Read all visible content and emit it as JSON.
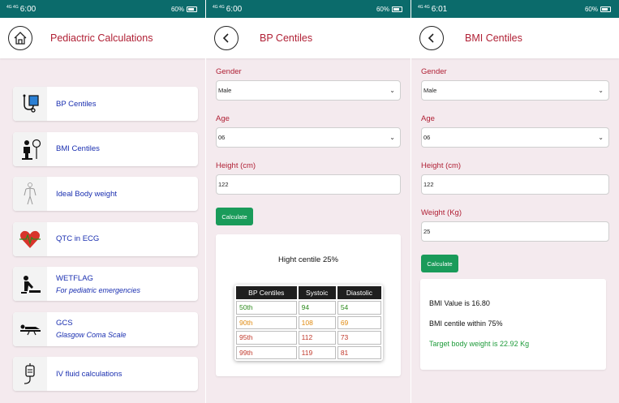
{
  "status_bars": [
    {
      "signal": "4G 4G",
      "time": "6:00",
      "battery": "60%"
    },
    {
      "signal": "4G 4G",
      "time": "6:00",
      "battery": "60%"
    },
    {
      "signal": "4G 4G",
      "time": "6:01",
      "battery": "60%"
    }
  ],
  "screen1": {
    "title": "Pediactric Calculations",
    "items": [
      {
        "label": "BP Centiles",
        "sub": "",
        "icon": "bp-monitor-icon"
      },
      {
        "label": "BMI Centiles",
        "sub": "",
        "icon": "bmi-scale-icon"
      },
      {
        "label": "Ideal Body weight",
        "sub": "",
        "icon": "body-figure-icon"
      },
      {
        "label": "QTC in ECG",
        "sub": "",
        "icon": "heart-ecg-icon"
      },
      {
        "label": "WETFLAG",
        "sub": "For pediatric emergencies",
        "icon": "cpr-icon"
      },
      {
        "label": "GCS",
        "sub": "Glasgow Coma Scale",
        "icon": "lying-person-icon"
      },
      {
        "label": "IV fluid calculations",
        "sub": "",
        "icon": "iv-drip-icon"
      }
    ]
  },
  "screen2": {
    "title": "BP Centiles",
    "gender_label": "Gender",
    "gender_value": "Male",
    "age_label": "Age",
    "age_value": "06",
    "height_label": "Height (cm)",
    "height_value": "122",
    "calc_label": "Calculate",
    "result_title": "Hight centile 25%",
    "table": {
      "headers": [
        "BP Centiles",
        "Systoic",
        "Diastolic"
      ],
      "rows": [
        {
          "cells": [
            "50th",
            "94",
            "54"
          ],
          "color": "#2e8b1e"
        },
        {
          "cells": [
            "90th",
            "108",
            "69"
          ],
          "color": "#e08a10"
        },
        {
          "cells": [
            "95th",
            "112",
            "73"
          ],
          "color": "#c0392b"
        },
        {
          "cells": [
            "99th",
            "119",
            "81"
          ],
          "color": "#c0392b"
        }
      ]
    }
  },
  "screen3": {
    "title": "BMI Centiles",
    "gender_label": "Gender",
    "gender_value": "Male",
    "age_label": "Age",
    "age_value": "06",
    "height_label": "Height (cm)",
    "height_value": "122",
    "weight_label": "Weight (Kg)",
    "weight_value": "25",
    "calc_label": "Calculate",
    "bmi_value": "BMI Value is 16.80",
    "bmi_centile": "BMI centile within 75%",
    "target_weight": "Target body weight is 22.92 Kg",
    "target_color": "#1e9b3a"
  }
}
